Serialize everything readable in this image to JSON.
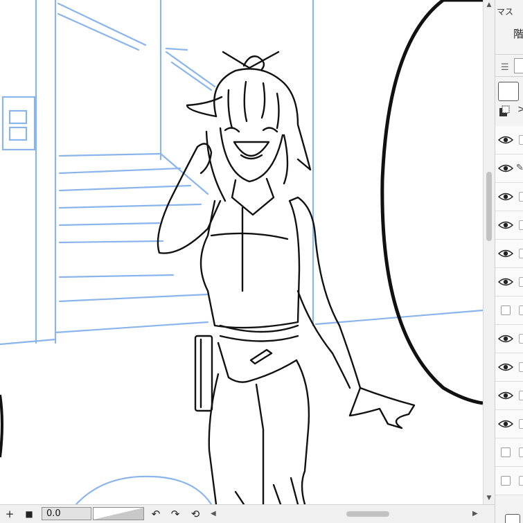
{
  "panel": {
    "title": "マス",
    "subtitle": "階",
    "menu_icon": "hamburger-menu-icon",
    "layer_rows": [
      {
        "type": "visible",
        "icon": "eye-icon",
        "extra": "lock"
      },
      {
        "type": "visible",
        "icon": "eye-icon",
        "extra": "pen"
      },
      {
        "type": "visible",
        "icon": "eye-icon",
        "extra": "lock"
      },
      {
        "type": "visible",
        "icon": "eye-icon",
        "extra": "lock"
      },
      {
        "type": "visible",
        "icon": "eye-icon",
        "extra": "lock"
      },
      {
        "type": "visible",
        "icon": "eye-icon",
        "extra": "lock"
      },
      {
        "type": "hidden",
        "icon": "checkbox",
        "extra": "lock"
      },
      {
        "type": "visible",
        "icon": "eye-icon",
        "extra": "lock"
      },
      {
        "type": "visible",
        "icon": "eye-icon",
        "extra": "lock"
      },
      {
        "type": "visible",
        "icon": "eye-icon",
        "extra": "lock"
      },
      {
        "type": "visible",
        "icon": "eye-icon",
        "extra": "lock"
      },
      {
        "type": "hidden",
        "icon": "checkbox",
        "extra": "lock"
      },
      {
        "type": "hidden",
        "icon": "checkbox",
        "extra": "lock"
      }
    ]
  },
  "toolbar": {
    "add_icon": "+",
    "stop_icon": "■",
    "zoom_value": "0.0",
    "undo_icon": "↶",
    "redo_icon": "↷",
    "reset_icon": "⟲"
  },
  "colors": {
    "sketch_blue": "#8ab4ec",
    "ink": "#111111",
    "panel_bg": "#f3f3f3",
    "toolbar_bg": "#f0f0f0"
  }
}
